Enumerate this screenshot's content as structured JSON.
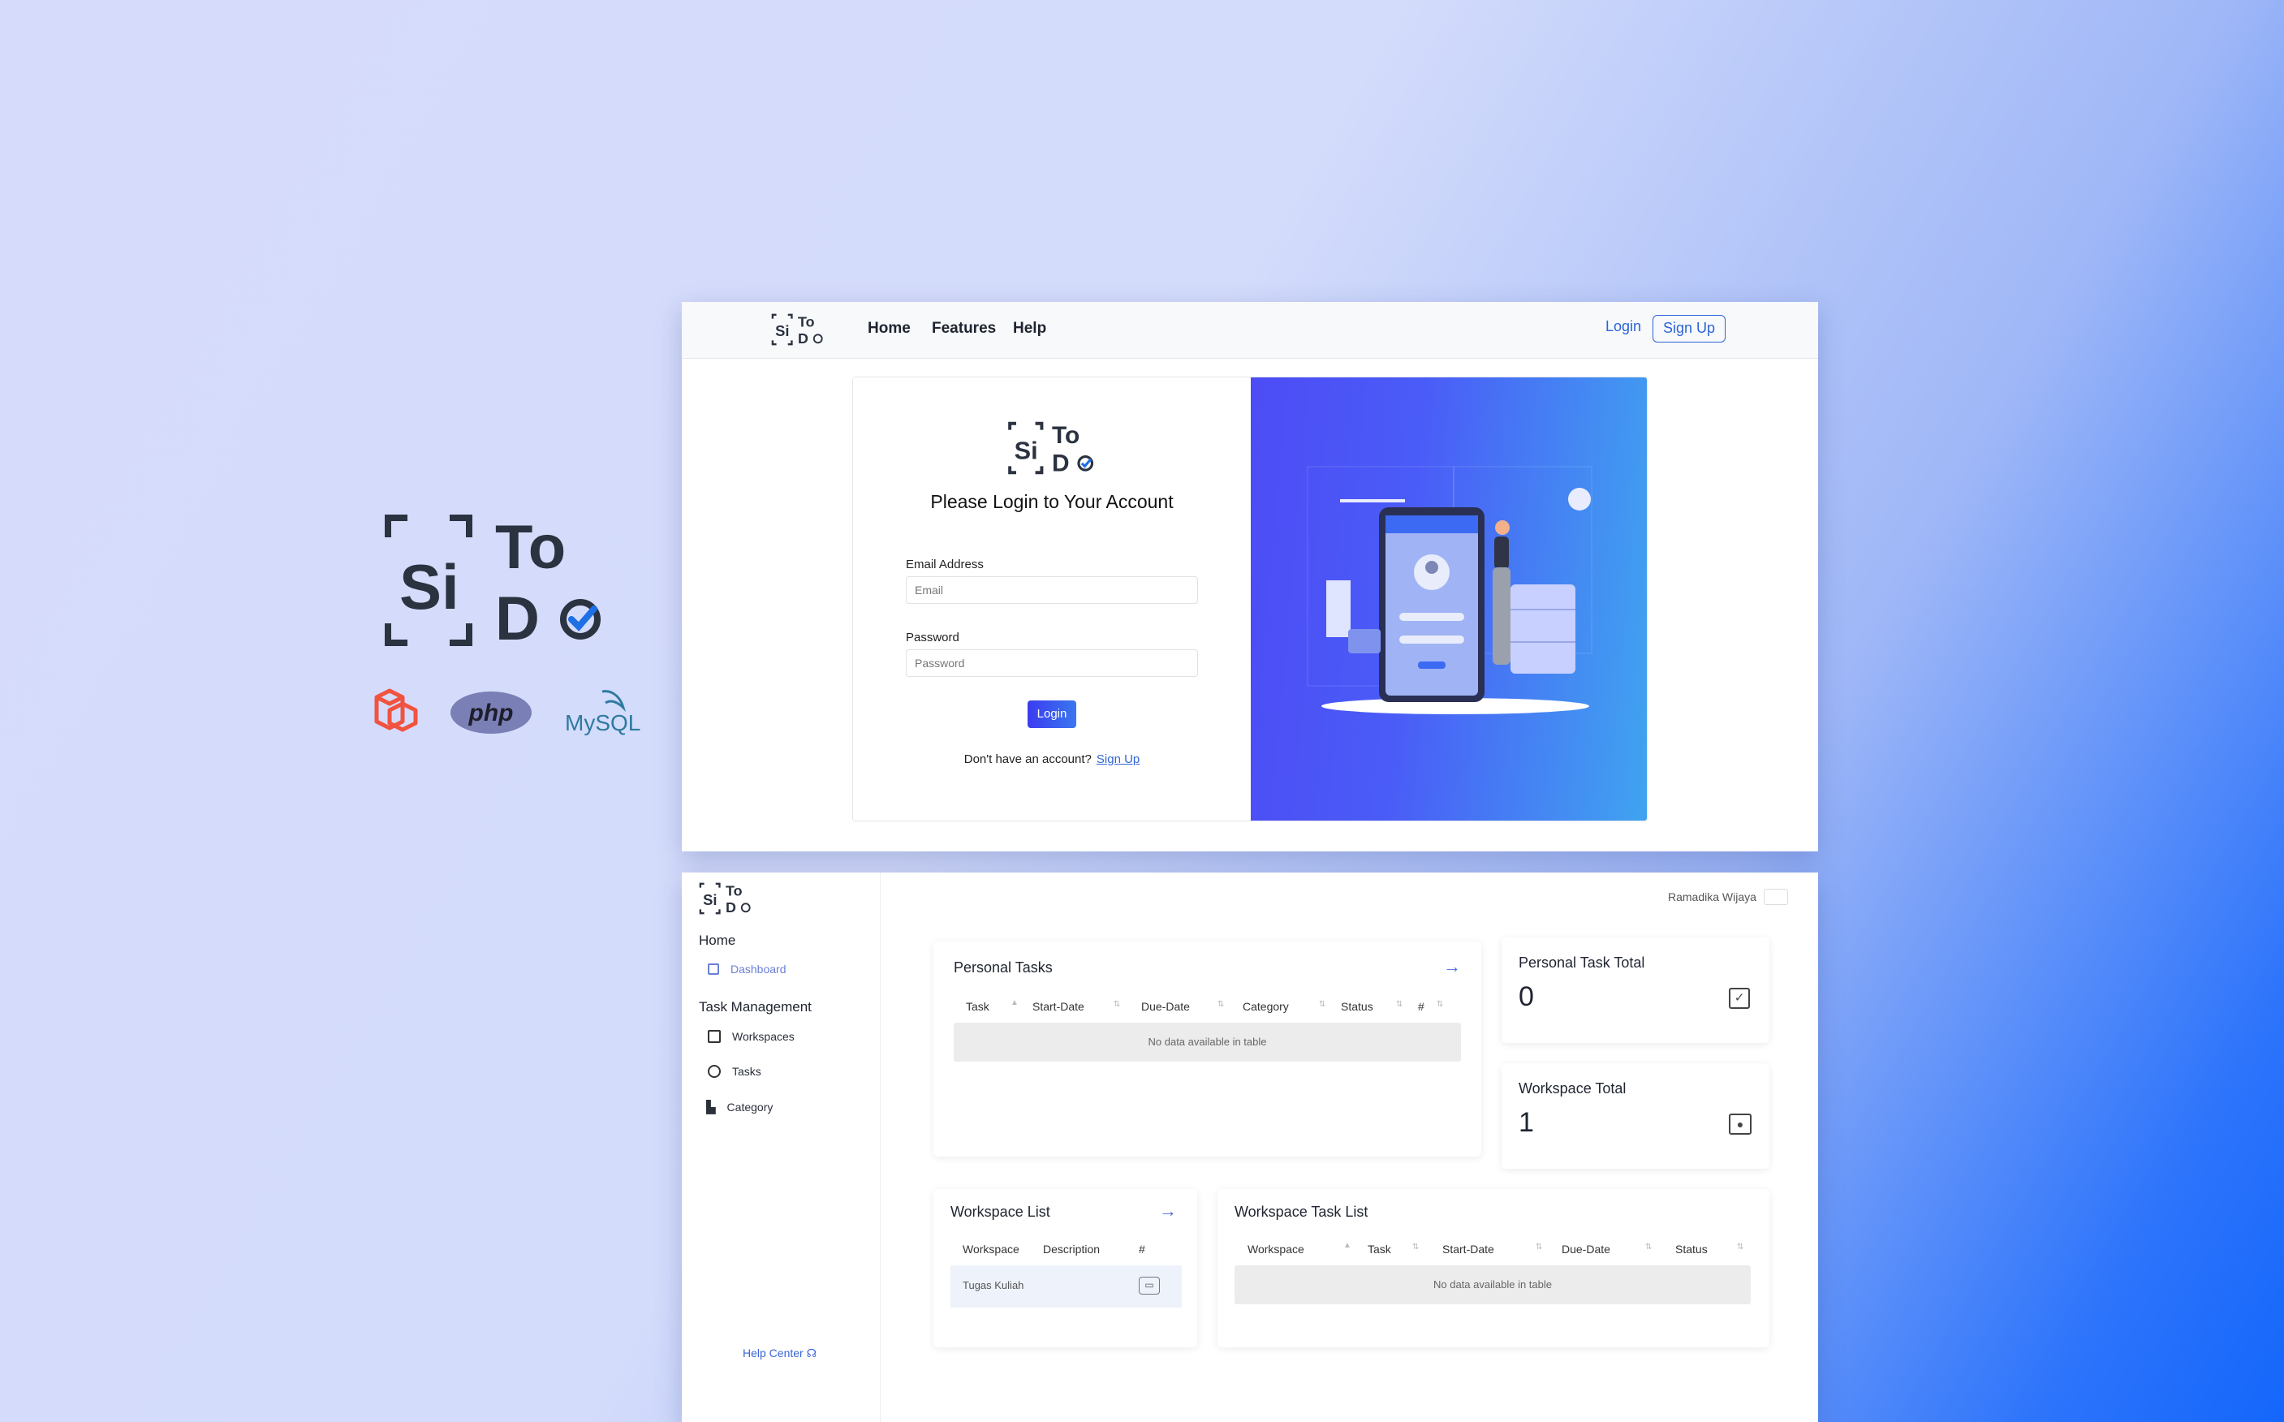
{
  "brand": {
    "name_top": "To",
    "name_bottom_d": "D",
    "mark": "Si"
  },
  "tech_logos": [
    "laravel-logo",
    "php-logo",
    "mysql-logo"
  ],
  "tech_text": {
    "php": "php",
    "mysql": "MySQL"
  },
  "landing": {
    "nav": {
      "home": "Home",
      "features": "Features",
      "help": "Help",
      "login": "Login",
      "signup": "Sign Up"
    },
    "card": {
      "title": "Please Login to Your Account",
      "email_label": "Email Address",
      "email_placeholder": "Email",
      "password_label": "Password",
      "password_placeholder": "Password",
      "login_button": "Login",
      "no_account": "Don't have an account?",
      "signup_link": "Sign Up"
    }
  },
  "dashboard": {
    "user": "Ramadika Wijaya",
    "sidebar": {
      "home_heading": "Home",
      "dashboard": "Dashboard",
      "task_heading": "Task Management",
      "workspaces": "Workspaces",
      "tasks": "Tasks",
      "category": "Category",
      "help_center": "Help Center"
    },
    "personal_tasks": {
      "title": "Personal Tasks",
      "columns": [
        "Task",
        "Start-Date",
        "Due-Date",
        "Category",
        "Status",
        "#"
      ],
      "empty": "No data available in table"
    },
    "personal_total": {
      "title": "Personal Task Total",
      "value": "0"
    },
    "workspace_total": {
      "title": "Workspace Total",
      "value": "1"
    },
    "workspace_list": {
      "title": "Workspace List",
      "columns": [
        "Workspace",
        "Description",
        "#"
      ],
      "rows": [
        {
          "workspace": "Tugas Kuliah",
          "description": ""
        }
      ]
    },
    "workspace_task_list": {
      "title": "Workspace Task List",
      "columns": [
        "Workspace",
        "Task",
        "Start-Date",
        "Due-Date",
        "Status"
      ],
      "empty": "No data available in table"
    }
  }
}
